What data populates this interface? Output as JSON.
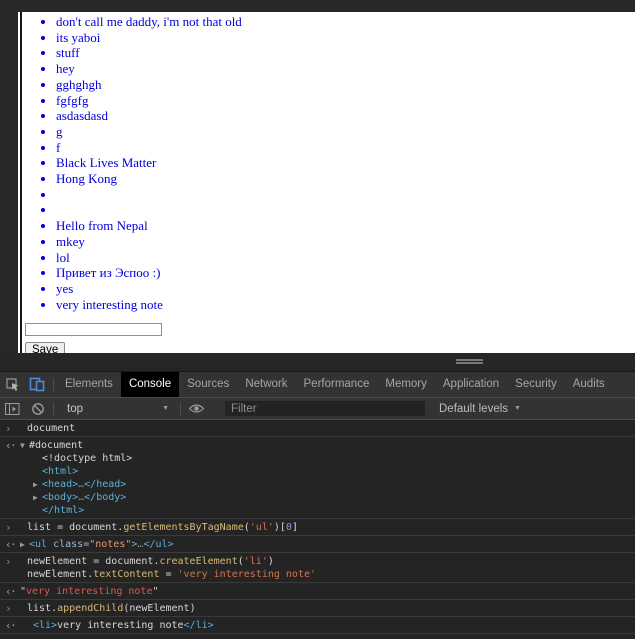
{
  "page": {
    "notes": [
      "don't call me daddy, i'm not that old",
      "its yaboi",
      "stuff",
      "hey",
      "gghghgh",
      "fgfgfg",
      "asdasdasd",
      "g",
      "f",
      "Black Lives Matter",
      "Hong Kong",
      "",
      "",
      "Hello from Nepal",
      "mkey",
      "lol",
      "Привет из Эспоо :)",
      "yes",
      "very interesting note"
    ],
    "note_input_value": "",
    "save_label": "Save",
    "note_color": "#0000dd"
  },
  "devtools": {
    "tabs": [
      "Elements",
      "Console",
      "Sources",
      "Network",
      "Performance",
      "Memory",
      "Application",
      "Security",
      "Audits"
    ],
    "active_tab": "Console",
    "toolbar": {
      "context": "top",
      "filter_placeholder": "Filter",
      "levels": "Default levels"
    },
    "icons": [
      "inspect-icon",
      "toggle-device-toolbar-icon",
      "console-sidebar-icon",
      "clear-console-icon",
      "eye-icon",
      "caret-down-icon"
    ],
    "colors": {
      "toolbar_bg": "#333333",
      "console_bg": "#242424",
      "active_tab_bg": "#000000",
      "accent_blue": "#4e8ae0",
      "tag_blue": "#5db0d7",
      "string_orange": "#d2734f",
      "result_red": "#de584c",
      "function_yellow": "#d9ba75",
      "number_purple": "#a58fdc"
    },
    "console_rows": [
      {
        "kind": "input",
        "lines": [
          {
            "toks": [
              {
                "t": "document",
                "c": "w"
              }
            ]
          }
        ]
      },
      {
        "kind": "result",
        "lines": [
          {
            "marker": "▼",
            "toks": [
              {
                "t": "#document",
                "c": "w"
              }
            ]
          },
          {
            "indent": 1,
            "marker": "",
            "toks": [
              {
                "t": "<!doctype html>",
                "c": "w"
              }
            ]
          },
          {
            "indent": 1,
            "marker": "",
            "toks": [
              {
                "t": "<html>",
                "c": "tag"
              }
            ]
          },
          {
            "indent": 1,
            "marker": "▶",
            "toks": [
              {
                "t": "<head>",
                "c": "tag"
              },
              {
                "t": "…",
                "c": "dim"
              },
              {
                "t": "</head>",
                "c": "tag"
              }
            ]
          },
          {
            "indent": 1,
            "marker": "▶",
            "toks": [
              {
                "t": "<body>",
                "c": "tag"
              },
              {
                "t": "…",
                "c": "dim"
              },
              {
                "t": "</body>",
                "c": "tag"
              }
            ]
          },
          {
            "indent": 1,
            "marker": "",
            "toks": [
              {
                "t": "</html>",
                "c": "tag"
              }
            ]
          }
        ]
      },
      {
        "kind": "input",
        "lines": [
          {
            "toks": [
              {
                "t": "list = document.",
                "c": "w"
              },
              {
                "t": "getElementsByTagName",
                "c": "y"
              },
              {
                "t": "(",
                "c": "w"
              },
              {
                "t": "'ul'",
                "c": "s"
              },
              {
                "t": ")[",
                "c": "w"
              },
              {
                "t": "0",
                "c": "n"
              },
              {
                "t": "]",
                "c": "w"
              }
            ]
          }
        ]
      },
      {
        "kind": "result",
        "lines": [
          {
            "marker": "▶",
            "toks": [
              {
                "t": "<ul ",
                "c": "tag"
              },
              {
                "t": "class=",
                "c": "attr"
              },
              {
                "t": "\"notes\"",
                "c": "val"
              },
              {
                "t": ">",
                "c": "tag"
              },
              {
                "t": "…",
                "c": "dim"
              },
              {
                "t": "</ul>",
                "c": "tag"
              }
            ]
          }
        ]
      },
      {
        "kind": "input",
        "lines": [
          {
            "toks": [
              {
                "t": "newElement = document.",
                "c": "w"
              },
              {
                "t": "createElement",
                "c": "y"
              },
              {
                "t": "(",
                "c": "w"
              },
              {
                "t": "'li'",
                "c": "s"
              },
              {
                "t": ")",
                "c": "w"
              }
            ]
          },
          {
            "toks": [
              {
                "t": "newElement.",
                "c": "w"
              },
              {
                "t": "textContent",
                "c": "y"
              },
              {
                "t": " = ",
                "c": "w"
              },
              {
                "t": "'very interesting note'",
                "c": "s"
              }
            ]
          }
        ]
      },
      {
        "kind": "result",
        "lines": [
          {
            "toks": [
              {
                "t": "\"",
                "c": "w"
              },
              {
                "t": "very interesting note",
                "c": "r"
              },
              {
                "t": "\"",
                "c": "w"
              }
            ]
          }
        ]
      },
      {
        "kind": "input",
        "lines": [
          {
            "toks": [
              {
                "t": "list.",
                "c": "w"
              },
              {
                "t": "appendChild",
                "c": "y"
              },
              {
                "t": "(newElement)",
                "c": "w"
              }
            ]
          }
        ]
      },
      {
        "kind": "result",
        "lines": [
          {
            "indent": 1,
            "toks": [
              {
                "t": "<li>",
                "c": "tag"
              },
              {
                "t": "very interesting note",
                "c": "w"
              },
              {
                "t": "</li>",
                "c": "tag"
              }
            ]
          }
        ]
      }
    ]
  }
}
